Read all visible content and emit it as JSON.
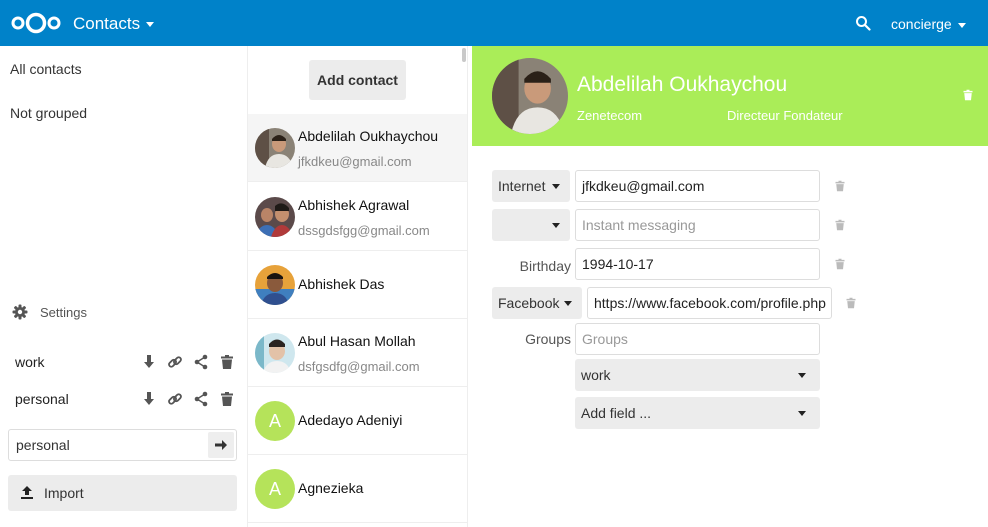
{
  "header": {
    "app_title": "Contacts",
    "user": "concierge"
  },
  "nav": {
    "all_contacts": "All contacts",
    "not_grouped": "Not grouped",
    "settings": "Settings",
    "address_books": [
      {
        "name": "work"
      },
      {
        "name": "personal"
      }
    ],
    "new_addressbook_value": "personal",
    "import_label": "Import"
  },
  "list": {
    "add_contact_label": "Add contact",
    "contacts": [
      {
        "name": "Abdelilah Oukhaychou",
        "email": "jfkdkeu@gmail.com",
        "selected": true
      },
      {
        "name": "Abhishek Agrawal",
        "email": "dssgdsfgg@gmail.com"
      },
      {
        "name": "Abhishek Das",
        "email": ""
      },
      {
        "name": "Abul Hasan Mollah",
        "email": "dsfgsdfg@gmail.com"
      },
      {
        "name": "Adedayo Adeniyi",
        "email": "",
        "initial": "A"
      },
      {
        "name": "Agnezieka",
        "email": "",
        "initial": "A"
      }
    ]
  },
  "details": {
    "name": "Abdelilah Oukhaychou",
    "org": "Zenetecom",
    "title": "Directeur Fondateur",
    "email_type": "Internet",
    "email_value": "jfkdkeu@gmail.com",
    "im_type": "",
    "im_placeholder": "Instant messaging",
    "birthday_label": "Birthday",
    "birthday_value": "1994-10-17",
    "social_type": "Facebook",
    "social_value": "https://www.facebook.com/profile.php",
    "groups_label": "Groups",
    "groups_placeholder": "Groups",
    "group_value": "work",
    "add_field_label": "Add field ..."
  },
  "colors": {
    "header_bg": "#0082c9",
    "detail_header_bg": "#aaed58",
    "avatar_letter_bg": "#b5e35a"
  }
}
